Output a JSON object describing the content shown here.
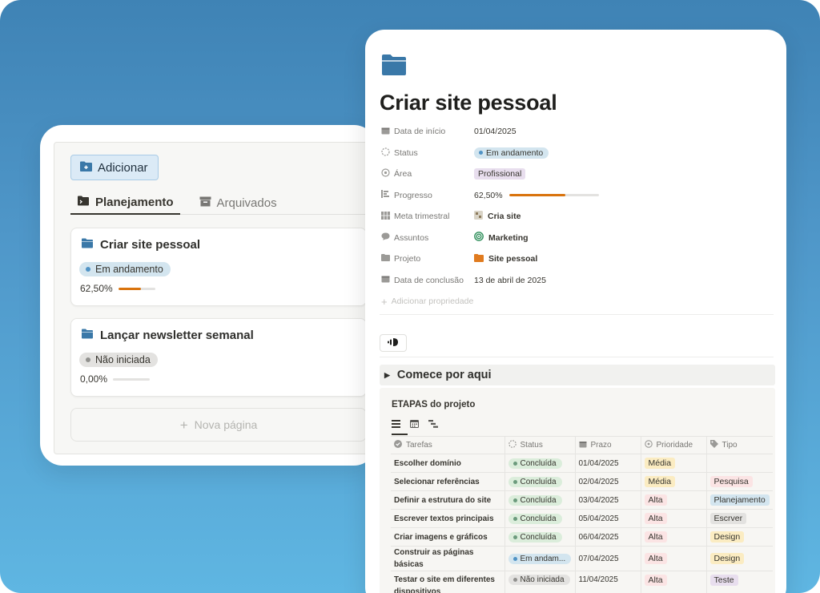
{
  "left_panel": {
    "add_button": "Adicionar",
    "tabs": [
      {
        "label": "Planejamento",
        "active": true
      },
      {
        "label": "Arquivados",
        "active": false
      }
    ],
    "cards": [
      {
        "title": "Criar site pessoal",
        "status": "Em andamento",
        "progress_label": "62,50%",
        "progress": 0.625
      },
      {
        "title": "Lançar newsletter semanal",
        "status": "Não iniciada",
        "progress_label": "0,00%",
        "progress": 0
      }
    ],
    "new_page": "Nova página"
  },
  "page": {
    "icon": "folder-icon",
    "title": "Criar site pessoal",
    "properties": {
      "start_date": {
        "label": "Data de início",
        "value": "01/04/2025"
      },
      "status": {
        "label": "Status",
        "value": "Em andamento"
      },
      "area": {
        "label": "Área",
        "value": "Profissional"
      },
      "progress": {
        "label": "Progresso",
        "value": "62,50%",
        "fraction": 0.625
      },
      "quarterly_goal": {
        "label": "Meta trimestral",
        "value": "Cria site"
      },
      "subjects": {
        "label": "Assuntos",
        "value": "Marketing"
      },
      "project": {
        "label": "Projeto",
        "value": "Site pessoal"
      },
      "end_date": {
        "label": "Data de conclusão",
        "value": "13 de abril de 2025"
      },
      "add_property": "Adicionar propriedade"
    },
    "toggle": "Comece por aqui",
    "database": {
      "title": "ETAPAS do projeto",
      "columns": [
        "Tarefas",
        "Status",
        "Prazo",
        "Prioridade",
        "Tipo"
      ],
      "rows": [
        {
          "task": "Escolher domínio",
          "status": "Concluída",
          "deadline": "01/04/2025",
          "priority": "Média",
          "type": ""
        },
        {
          "task": "Selecionar referências",
          "status": "Concluída",
          "deadline": "02/04/2025",
          "priority": "Média",
          "type": "Pesquisa"
        },
        {
          "task": "Definir a estrutura do site",
          "status": "Concluída",
          "deadline": "03/04/2025",
          "priority": "Alta",
          "type": "Planejamento"
        },
        {
          "task": "Escrever textos principais",
          "status": "Concluída",
          "deadline": "05/04/2025",
          "priority": "Alta",
          "type": "Escrver"
        },
        {
          "task": "Criar imagens e gráficos",
          "status": "Concluída",
          "deadline": "06/04/2025",
          "priority": "Alta",
          "type": "Design"
        },
        {
          "task": "Construir as páginas básicas",
          "status": "Em andam...",
          "deadline": "07/04/2025",
          "priority": "Alta",
          "type": "Design"
        },
        {
          "task": "Testar o site em diferentes dispositivos",
          "status": "Não iniciada",
          "deadline": "11/04/2025",
          "priority": "Alta",
          "type": "Teste"
        }
      ]
    }
  },
  "colors": {
    "background_top": "#3f83b5",
    "background_bottom": "#5fb6e2",
    "folder_blue": "#3a78a8",
    "progress_orange": "#d9730d"
  }
}
